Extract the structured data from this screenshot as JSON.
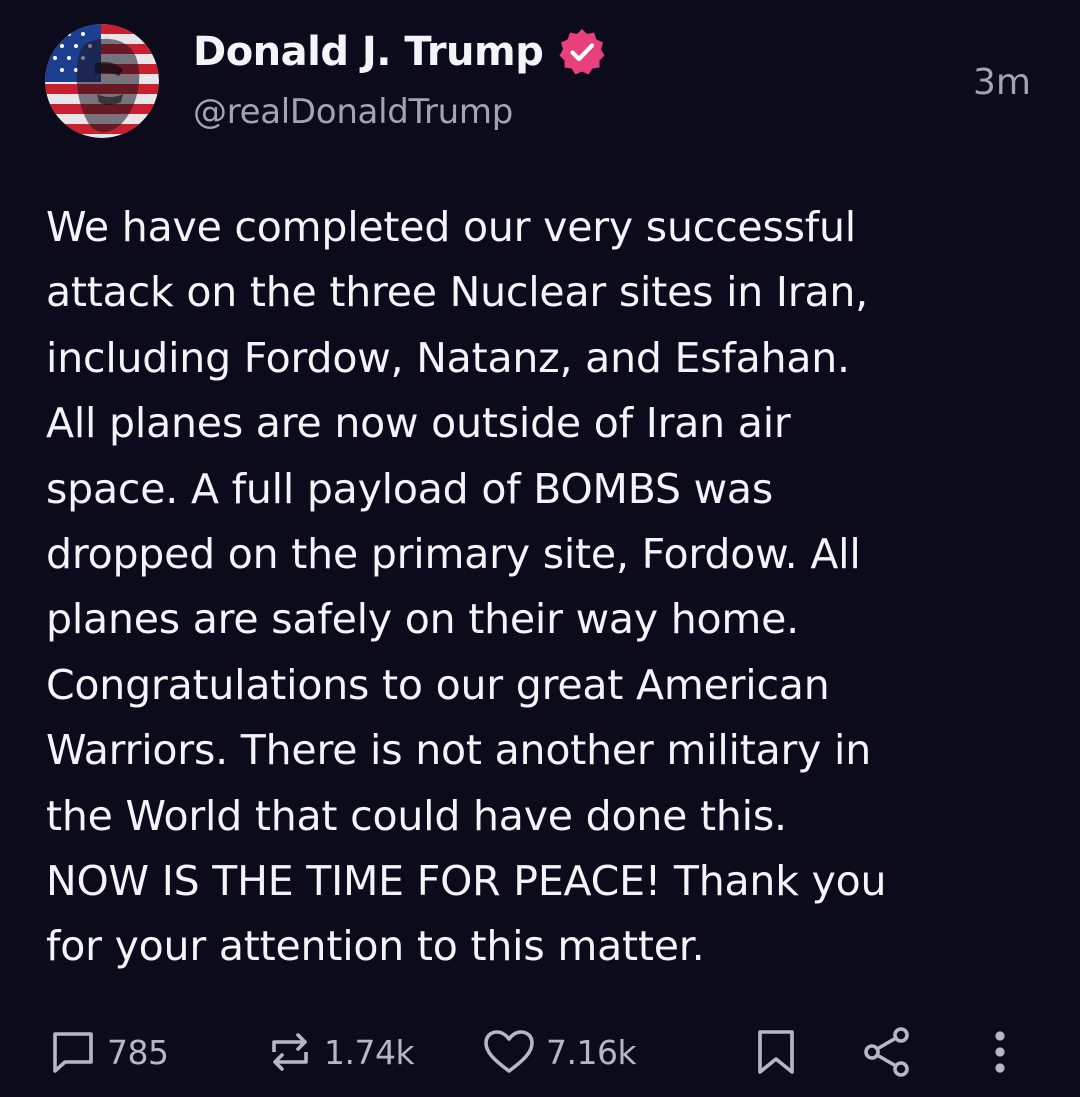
{
  "post": {
    "author": {
      "display_name": "Donald J. Trump",
      "handle": "@realDonaldTrump",
      "verified_badge_icon": "verified-badge-icon",
      "avatar_icon": "avatar-flag-portrait"
    },
    "timestamp": "3m",
    "body_lines": [
      "We have completed our very successful",
      "attack on the three Nuclear sites in Iran,",
      "including Fordow, Natanz, and Esfahan.",
      "All planes are now outside of Iran air",
      "space. A full payload of BOMBS was",
      "dropped on the primary site, Fordow. All",
      "planes are safely on their way home.",
      "Congratulations to our great American",
      "Warriors. There is not another military in",
      "the World that could have done this.",
      "NOW IS THE TIME FOR PEACE! Thank you",
      "for your attention to this matter."
    ],
    "actions": {
      "reply": {
        "icon": "reply-icon",
        "count": "785"
      },
      "repost": {
        "icon": "repost-icon",
        "count": "1.74k"
      },
      "like": {
        "icon": "heart-icon",
        "count": "7.16k"
      },
      "bookmark": {
        "icon": "bookmark-icon"
      },
      "share": {
        "icon": "share-icon"
      },
      "more": {
        "icon": "more-vertical-icon"
      }
    }
  },
  "colors": {
    "background": "#0c0b1c",
    "text_primary": "#f4f3f8",
    "text_secondary": "#a4a2b5",
    "action_icon": "#b8b6c6",
    "verified_badge": "#e8407a"
  }
}
